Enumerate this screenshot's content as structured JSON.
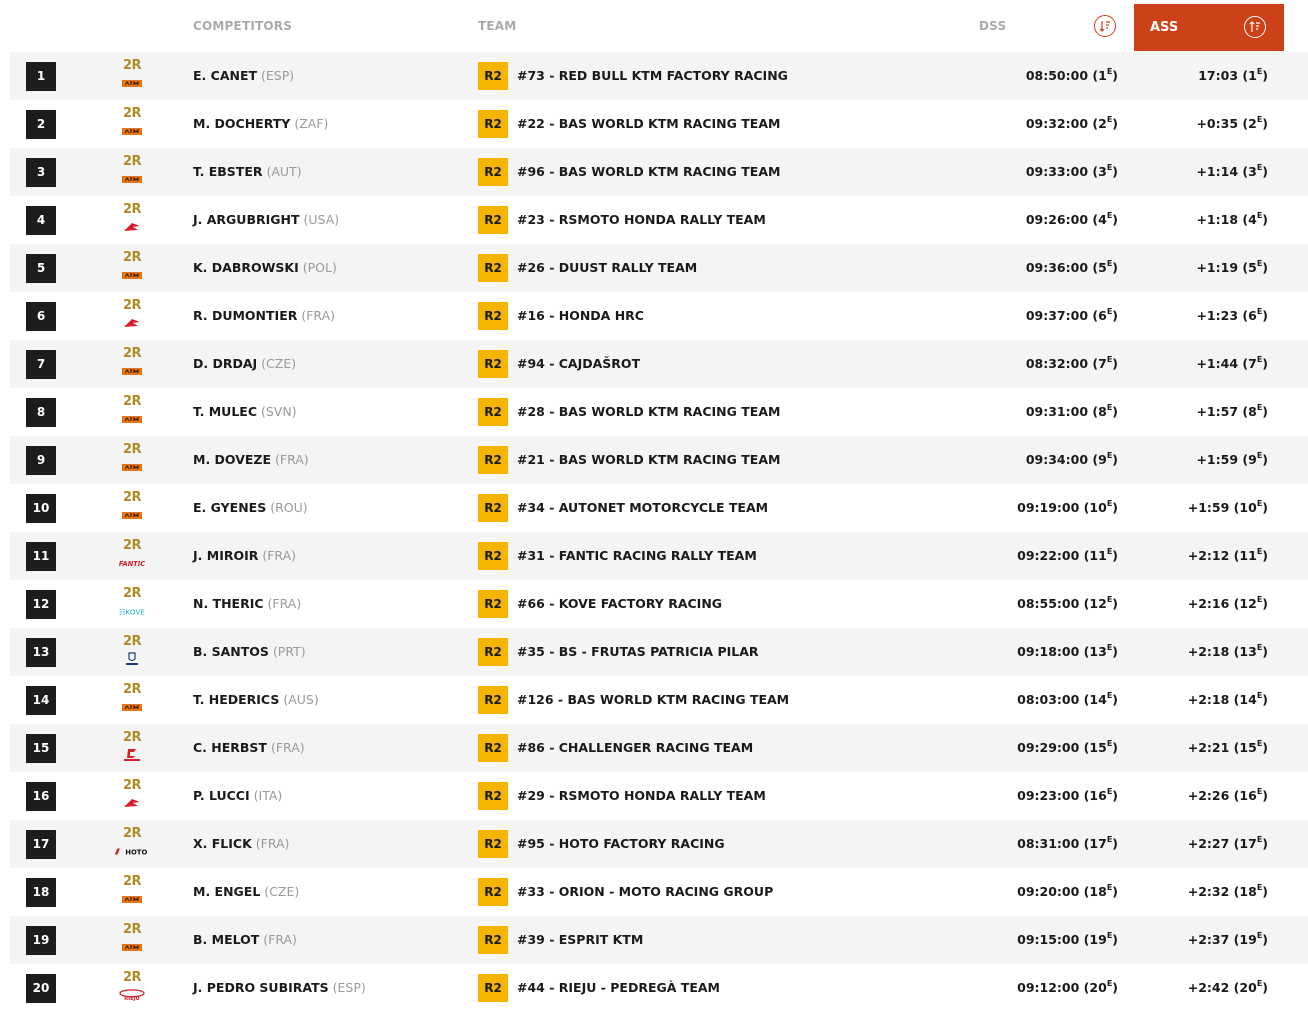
{
  "header": {
    "competitors": "COMPETITORS",
    "team": "TEAM",
    "dss": "DSS",
    "ass": "ASS"
  },
  "colors": {
    "accent": "#cd4119",
    "badge": "#f5b400",
    "category": "#b08a28"
  },
  "rows": [
    {
      "rank": "1",
      "category": "2R",
      "brand": "ktm",
      "name": "E. CANET",
      "country": "(ESP)",
      "badge": "R2",
      "team": "#73 - RED BULL KTM FACTORY RACING",
      "dss_time": "08:50:00",
      "dss_pos": "1",
      "ass_time": "17:03",
      "ass_pos": "1"
    },
    {
      "rank": "2",
      "category": "2R",
      "brand": "ktm",
      "name": "M. DOCHERTY",
      "country": "(ZAF)",
      "badge": "R2",
      "team": "#22 - BAS WORLD KTM RACING TEAM",
      "dss_time": "09:32:00",
      "dss_pos": "2",
      "ass_time": "+0:35",
      "ass_pos": "2"
    },
    {
      "rank": "3",
      "category": "2R",
      "brand": "ktm",
      "name": "T. EBSTER",
      "country": "(AUT)",
      "badge": "R2",
      "team": "#96 - BAS WORLD KTM RACING TEAM",
      "dss_time": "09:33:00",
      "dss_pos": "3",
      "ass_time": "+1:14",
      "ass_pos": "3"
    },
    {
      "rank": "4",
      "category": "2R",
      "brand": "honda",
      "name": "J. ARGUBRIGHT",
      "country": "(USA)",
      "badge": "R2",
      "team": "#23 - RSMOTO HONDA RALLY TEAM",
      "dss_time": "09:26:00",
      "dss_pos": "4",
      "ass_time": "+1:18",
      "ass_pos": "4"
    },
    {
      "rank": "5",
      "category": "2R",
      "brand": "ktm",
      "name": "K. DABROWSKI",
      "country": "(POL)",
      "badge": "R2",
      "team": "#26 - DUUST RALLY TEAM",
      "dss_time": "09:36:00",
      "dss_pos": "5",
      "ass_time": "+1:19",
      "ass_pos": "5"
    },
    {
      "rank": "6",
      "category": "2R",
      "brand": "honda",
      "name": "R. DUMONTIER",
      "country": "(FRA)",
      "badge": "R2",
      "team": "#16 - HONDA HRC",
      "dss_time": "09:37:00",
      "dss_pos": "6",
      "ass_time": "+1:23",
      "ass_pos": "6"
    },
    {
      "rank": "7",
      "category": "2R",
      "brand": "ktm",
      "name": "D. DRDAJ",
      "country": "(CZE)",
      "badge": "R2",
      "team": "#94 - CAJDAŠROT",
      "dss_time": "08:32:00",
      "dss_pos": "7",
      "ass_time": "+1:44",
      "ass_pos": "7"
    },
    {
      "rank": "8",
      "category": "2R",
      "brand": "ktm",
      "name": "T. MULEC",
      "country": "(SVN)",
      "badge": "R2",
      "team": "#28 - BAS WORLD KTM RACING TEAM",
      "dss_time": "09:31:00",
      "dss_pos": "8",
      "ass_time": "+1:57",
      "ass_pos": "8"
    },
    {
      "rank": "9",
      "category": "2R",
      "brand": "ktm",
      "name": "M. DOVEZE",
      "country": "(FRA)",
      "badge": "R2",
      "team": "#21 - BAS WORLD KTM RACING TEAM",
      "dss_time": "09:34:00",
      "dss_pos": "9",
      "ass_time": "+1:59",
      "ass_pos": "9"
    },
    {
      "rank": "10",
      "category": "2R",
      "brand": "ktm",
      "name": "E. GYENES",
      "country": "(ROU)",
      "badge": "R2",
      "team": "#34 - AUTONET MOTORCYCLE TEAM",
      "dss_time": "09:19:00",
      "dss_pos": "10",
      "ass_time": "+1:59",
      "ass_pos": "10"
    },
    {
      "rank": "11",
      "category": "2R",
      "brand": "fantic",
      "name": "J. MIROIR",
      "country": "(FRA)",
      "badge": "R2",
      "team": "#31 - FANTIC RACING RALLY TEAM",
      "dss_time": "09:22:00",
      "dss_pos": "11",
      "ass_time": "+2:12",
      "ass_pos": "11"
    },
    {
      "rank": "12",
      "category": "2R",
      "brand": "kove",
      "name": "N. THERIC",
      "country": "(FRA)",
      "badge": "R2",
      "team": "#66 - KOVE FACTORY RACING",
      "dss_time": "08:55:00",
      "dss_pos": "12",
      "ass_time": "+2:16",
      "ass_pos": "12"
    },
    {
      "rank": "13",
      "category": "2R",
      "brand": "husqvarna",
      "name": "B. SANTOS",
      "country": "(PRT)",
      "badge": "R2",
      "team": "#35 - BS - FRUTAS PATRICIA PILAR",
      "dss_time": "09:18:00",
      "dss_pos": "13",
      "ass_time": "+2:18",
      "ass_pos": "13"
    },
    {
      "rank": "14",
      "category": "2R",
      "brand": "ktm",
      "name": "T. HEDERICS",
      "country": "(AUS)",
      "badge": "R2",
      "team": "#126 - BAS WORLD KTM RACING TEAM",
      "dss_time": "08:03:00",
      "dss_pos": "14",
      "ass_time": "+2:18",
      "ass_pos": "14"
    },
    {
      "rank": "15",
      "category": "2R",
      "brand": "gasgas",
      "name": "C. HERBST",
      "country": "(FRA)",
      "badge": "R2",
      "team": "#86 - CHALLENGER RACING TEAM",
      "dss_time": "09:29:00",
      "dss_pos": "15",
      "ass_time": "+2:21",
      "ass_pos": "15"
    },
    {
      "rank": "16",
      "category": "2R",
      "brand": "honda",
      "name": "P. LUCCI",
      "country": "(ITA)",
      "badge": "R2",
      "team": "#29 - RSMOTO HONDA RALLY TEAM",
      "dss_time": "09:23:00",
      "dss_pos": "16",
      "ass_time": "+2:26",
      "ass_pos": "16"
    },
    {
      "rank": "17",
      "category": "2R",
      "brand": "hoto",
      "name": "X. FLICK",
      "country": "(FRA)",
      "badge": "R2",
      "team": "#95 - HOTO FACTORY RACING",
      "dss_time": "08:31:00",
      "dss_pos": "17",
      "ass_time": "+2:27",
      "ass_pos": "17"
    },
    {
      "rank": "18",
      "category": "2R",
      "brand": "ktm",
      "name": "M. ENGEL",
      "country": "(CZE)",
      "badge": "R2",
      "team": "#33 - ORION - MOTO RACING GROUP",
      "dss_time": "09:20:00",
      "dss_pos": "18",
      "ass_time": "+2:32",
      "ass_pos": "18"
    },
    {
      "rank": "19",
      "category": "2R",
      "brand": "ktm",
      "name": "B. MELOT",
      "country": "(FRA)",
      "badge": "R2",
      "team": "#39 - ESPRIT KTM",
      "dss_time": "09:15:00",
      "dss_pos": "19",
      "ass_time": "+2:37",
      "ass_pos": "19"
    },
    {
      "rank": "20",
      "category": "2R",
      "brand": "rieju",
      "name": "J. PEDRO SUBIRATS",
      "country": "(ESP)",
      "badge": "R2",
      "team": "#44 - RIEJU - PEDREGÀ TEAM",
      "dss_time": "09:12:00",
      "dss_pos": "20",
      "ass_time": "+2:42",
      "ass_pos": "20"
    }
  ],
  "ordinal_suffix": "E"
}
